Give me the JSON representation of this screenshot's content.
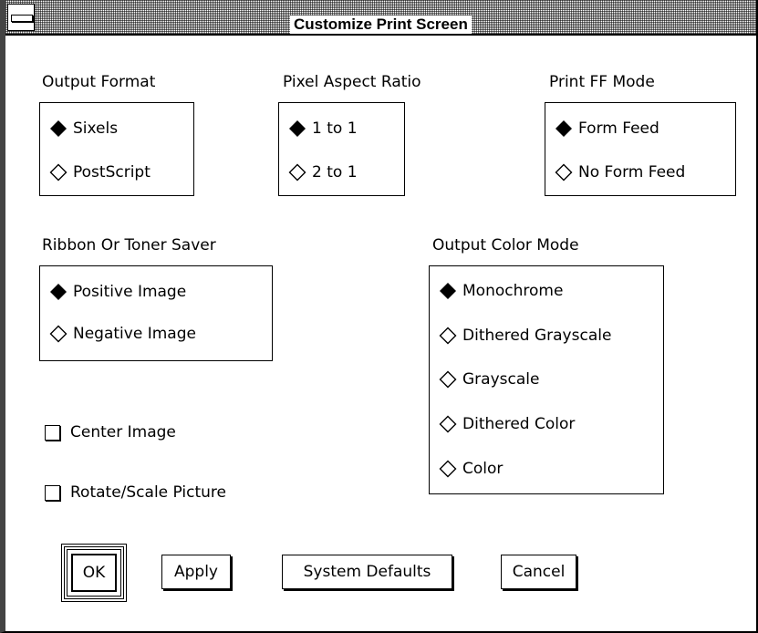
{
  "window": {
    "title": "Customize Print Screen"
  },
  "output_format": {
    "label": "Output Format",
    "options": [
      "Sixels",
      "PostScript"
    ],
    "selected": "Sixels"
  },
  "pixel_aspect_ratio": {
    "label": "Pixel Aspect Ratio",
    "options": [
      "1 to 1",
      "2 to 1"
    ],
    "selected": "1 to 1"
  },
  "print_ff_mode": {
    "label": "Print FF Mode",
    "options": [
      "Form Feed",
      "No Form Feed"
    ],
    "selected": "Form Feed"
  },
  "ribbon_toner": {
    "label": "Ribbon Or Toner Saver",
    "options": [
      "Positive Image",
      "Negative Image"
    ],
    "selected": "Positive Image"
  },
  "color_mode": {
    "label": "Output Color Mode",
    "options": [
      "Monochrome",
      "Dithered Grayscale",
      "Grayscale",
      "Dithered Color",
      "Color"
    ],
    "selected": "Monochrome"
  },
  "checkboxes": {
    "center_image": "Center Image",
    "rotate_scale": "Rotate/Scale Picture"
  },
  "buttons": {
    "ok": "OK",
    "apply": "Apply",
    "system_defaults": "System Defaults",
    "cancel": "Cancel"
  }
}
